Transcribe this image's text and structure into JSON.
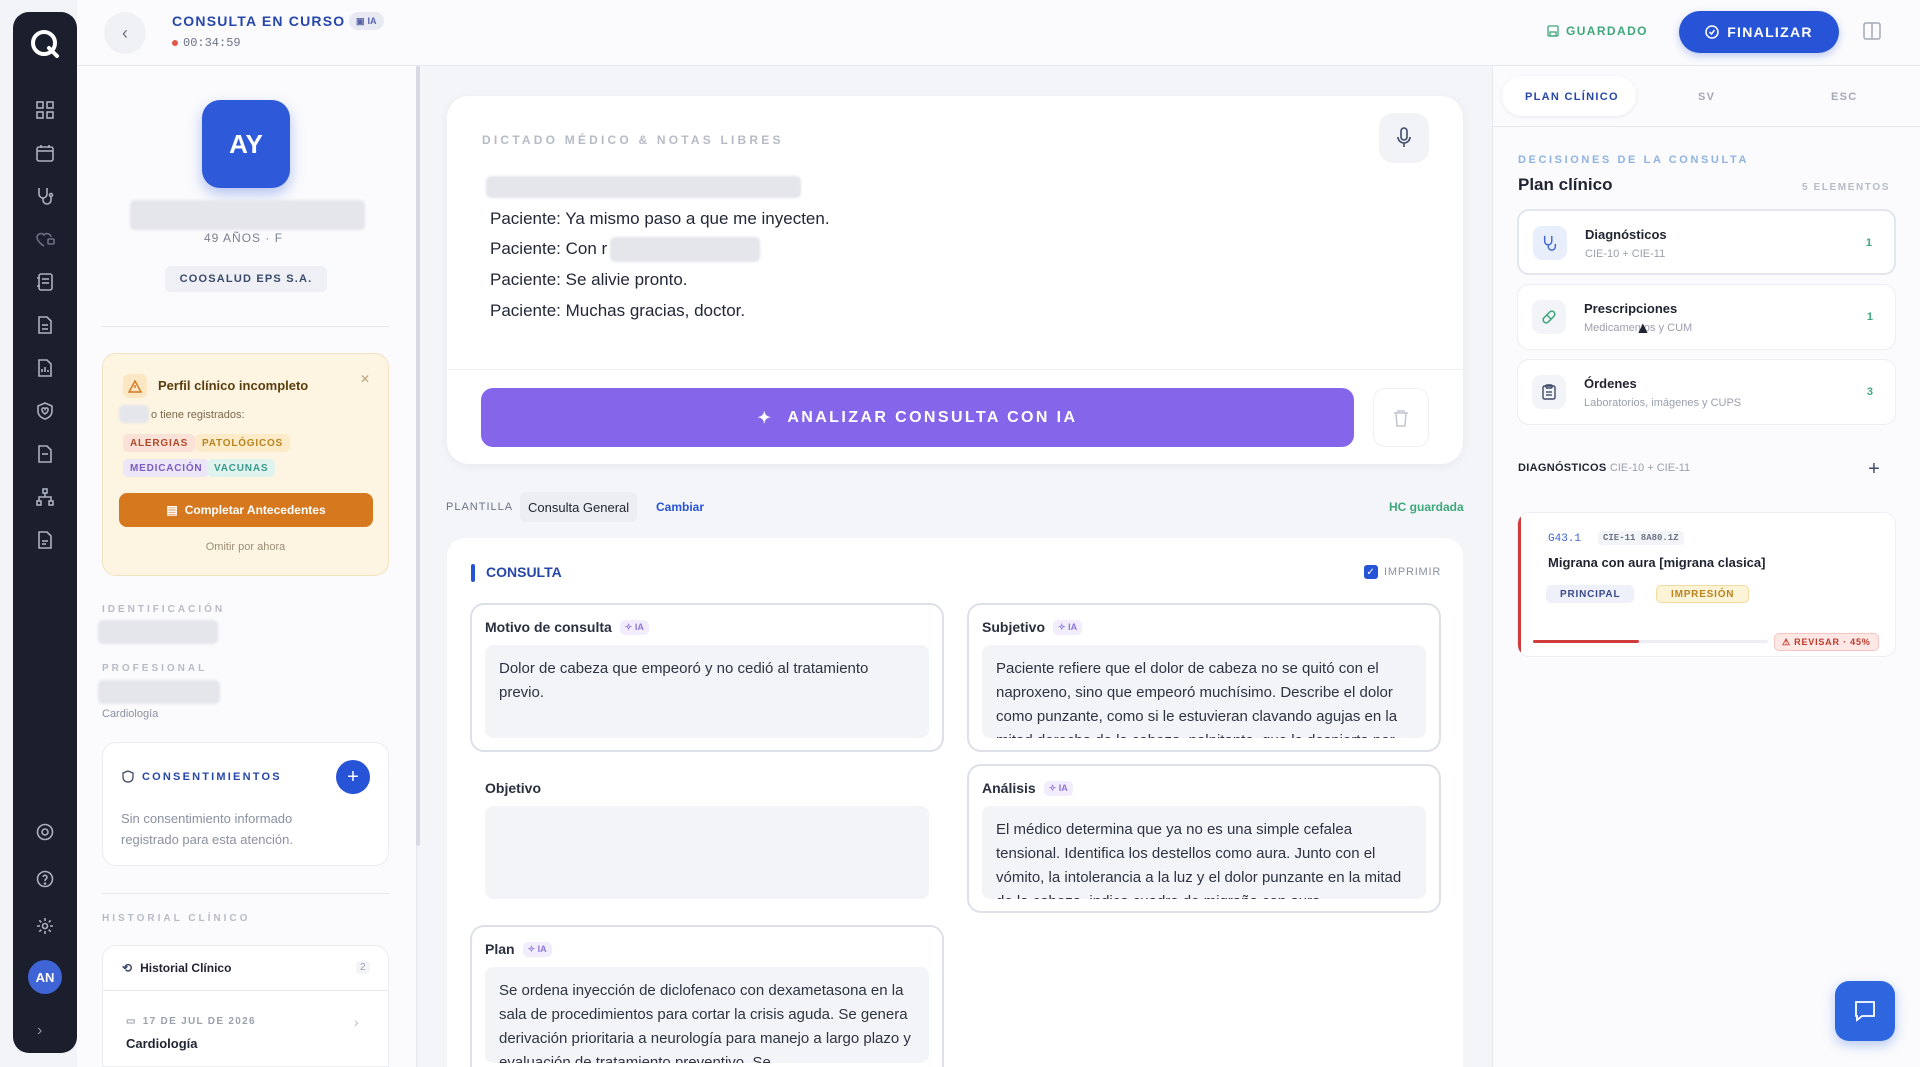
{
  "header": {
    "title": "CONSULTA EN CURSO",
    "ia_badge": "IA",
    "timer": "00:34:59",
    "saved_label": "GUARDADO",
    "finalize_label": "FINALIZAR"
  },
  "patient": {
    "initials": "AY",
    "age_sex": "49 AÑOS · F",
    "insurer": "COOSALUD EPS S.A."
  },
  "warning": {
    "title": "Perfil clínico incompleto",
    "subtitle": "o tiene registrados:",
    "tags": [
      "ALERGIAS",
      "PATOLÓGICOS",
      "MEDICACIÓN",
      "VACUNAS"
    ],
    "button": "Completar Antecedentes",
    "omit": "Omitir por ahora"
  },
  "sections": {
    "identificacion": "IDENTIFICACIÓN",
    "profesional": "PROFESIONAL",
    "specialty": "Cardiología",
    "historial": "HISTORIAL CLÍNICO"
  },
  "consents": {
    "title": "CONSENTIMIENTOS",
    "text_1": "Sin consentimiento informado",
    "text_2": "registrado para esta atención."
  },
  "history": {
    "title": "Historial Clínico",
    "count": "2",
    "date": "17 DE JUL DE 2026",
    "specialty": "Cardiología"
  },
  "dictation": {
    "label": "DICTADO MÉDICO & NOTAS LIBRES",
    "lines": [
      "Paciente: Ya mismo paso a que me inyecten.",
      "Paciente: Con r",
      "Paciente: Se alivie pronto.",
      "Paciente: Muchas gracias, doctor."
    ],
    "analyze_label": "ANALIZAR CONSULTA CON IA"
  },
  "template": {
    "label": "PLANTILLA",
    "name": "Consulta General",
    "change": "Cambiar",
    "status": "HC guardada"
  },
  "consulta": {
    "title": "CONSULTA",
    "print_label": "IMPRIMIR",
    "ia_tag": "IA",
    "motivo": {
      "label": "Motivo de consulta",
      "text": "Dolor de cabeza que empeoró y no cedió al tratamiento previo."
    },
    "subjetivo": {
      "label": "Subjetivo",
      "text": "Paciente refiere que el dolor de cabeza no se quitó con el naproxeno, sino que empeoró muchísimo. Describe el dolor como punzante, como si le estuvieran clavando agujas en la mitad derecha de la cabeza, palpitante, que le despierta por"
    },
    "objetivo": {
      "label": "Objetivo",
      "text": ""
    },
    "analisis": {
      "label": "Análisis",
      "text": "El médico determina que ya no es una simple cefalea tensional. Identifica los destellos como aura. Junto con el vómito, la intolerancia a la luz y el dolor punzante en la mitad de la cabeza, indica cuadro de migraña con aura"
    },
    "plan": {
      "label": "Plan",
      "text": "Se ordena inyección de diclofenaco con dexametasona en la sala de procedimientos para cortar la crisis aguda. Se genera derivación prioritaria a neurología para manejo a largo plazo y evaluación de tratamiento preventivo. Se"
    }
  },
  "right_panel": {
    "tabs": [
      "PLAN CLÍNICO",
      "SV",
      "ESC"
    ],
    "section_label": "DECISIONES DE LA CONSULTA",
    "title": "Plan clínico",
    "elements": "5 ELEMENTOS",
    "rows": [
      {
        "title": "Diagnósticos",
        "subtitle": "CIE-10 + CIE-11",
        "count": "1"
      },
      {
        "title": "Prescripciones",
        "subtitle": "Medicamentos y CUM",
        "count": "1"
      },
      {
        "title": "Órdenes",
        "subtitle": "Laboratorios, imágenes y CUPS",
        "count": "3"
      }
    ],
    "dx_header": "DIAGNÓSTICOS",
    "dx_header_sub": "CIE-10 + CIE-11",
    "dx": {
      "code": "G43.1",
      "code2": "CIE-11 8A80.1Z",
      "name": "Migrana con aura [migrana clasica]",
      "tag1": "PRINCIPAL",
      "tag2": "IMPRESIÓN",
      "review": "REVISAR · 45%",
      "review_progress": 0.45
    }
  },
  "user": {
    "initials": "AN"
  },
  "colors": {
    "primary": "#2753d6",
    "ai": "#8566eb",
    "rail": "#1b1f2d",
    "warning": "#d5781e",
    "success": "#3fa87a",
    "danger": "#d03b3b"
  }
}
